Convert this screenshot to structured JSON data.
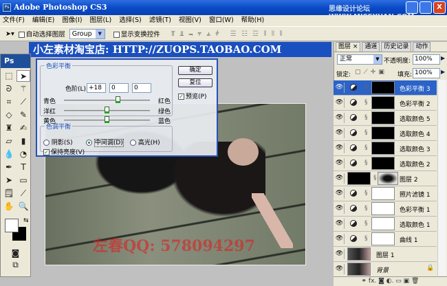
{
  "app": {
    "title": "Adobe Photoshop CS3",
    "watermark": "思缘设计论坛 WWW.MISSYUAN.COM",
    "close": "X"
  },
  "menu": [
    "文件(F)",
    "编辑(E)",
    "图像(I)",
    "图层(L)",
    "选择(S)",
    "滤镜(T)",
    "视图(V)",
    "窗口(W)",
    "帮助(H)"
  ],
  "options": {
    "auto_select_label": "自动选择图层",
    "auto_select_value": "Group",
    "show_transform_label": "显示变换控件",
    "align_icons": "⫪ ⫫ ⫬  ⫧ ⫨ ⫩",
    "distribute_icons": "☰ ☷ ☲  ⦀ ⦀ ⦀"
  },
  "banner": "小左素材淘宝店: HTTP://ZUOPS.TAOBAO.COM",
  "canvas_watermark": "左春QQ: 578094297",
  "toolbox": {
    "logo": "Ps"
  },
  "dialog": {
    "color_balance_legend": "色彩平衡",
    "levels_label": "色阶(L):",
    "levels": [
      "+18",
      "0",
      "0"
    ],
    "sliders": [
      {
        "left": "青色",
        "right": "红色",
        "value": 18
      },
      {
        "left": "洋红",
        "right": "绿色",
        "value": 0
      },
      {
        "left": "黄色",
        "right": "蓝色",
        "value": 0
      }
    ],
    "tone_legend": "色调平衡",
    "tones": [
      {
        "label": "阴影(S)",
        "checked": false
      },
      {
        "label": "中间调(D)",
        "checked": true
      },
      {
        "label": "高光(H)",
        "checked": false
      }
    ],
    "preserve_label": "保持亮度(V)",
    "ok": "确定",
    "reset": "复位",
    "preview_label": "预览(P)"
  },
  "layers": {
    "tabs": [
      "图层 ×",
      "通道",
      "历史记录",
      "动作"
    ],
    "blend_mode": "正常",
    "opacity_label": "不透明度:",
    "opacity": "100%",
    "lock_label": "锁定:",
    "fill_label": "填充:",
    "fill": "100%",
    "items": [
      {
        "name": "色彩平衡 3",
        "type": "adj",
        "mask": "black",
        "selected": true
      },
      {
        "name": "色彩平衡 2",
        "type": "adj",
        "mask": "black"
      },
      {
        "name": "选取颜色 5",
        "type": "adj",
        "mask": "black"
      },
      {
        "name": "选取颜色 4",
        "type": "adj",
        "mask": "black"
      },
      {
        "name": "选取颜色 3",
        "type": "adj",
        "mask": "black"
      },
      {
        "name": "选取颜色 2",
        "type": "adj",
        "mask": "black"
      },
      {
        "name": "图层 2",
        "type": "fill",
        "mask": "black"
      },
      {
        "name": "照片滤镜 1",
        "type": "adj",
        "mask": "white"
      },
      {
        "name": "色彩平衡 1",
        "type": "adj",
        "mask": "white"
      },
      {
        "name": "选取颜色 1",
        "type": "adj",
        "mask": "white"
      },
      {
        "name": "曲线 1",
        "type": "adj",
        "mask": "white"
      },
      {
        "name": "图层 1",
        "type": "image"
      },
      {
        "name": "背景",
        "type": "image",
        "locked": true
      }
    ],
    "bottom_icons": "⚭ fx. ◙ ◐. ▭ ▣ 🗑"
  }
}
